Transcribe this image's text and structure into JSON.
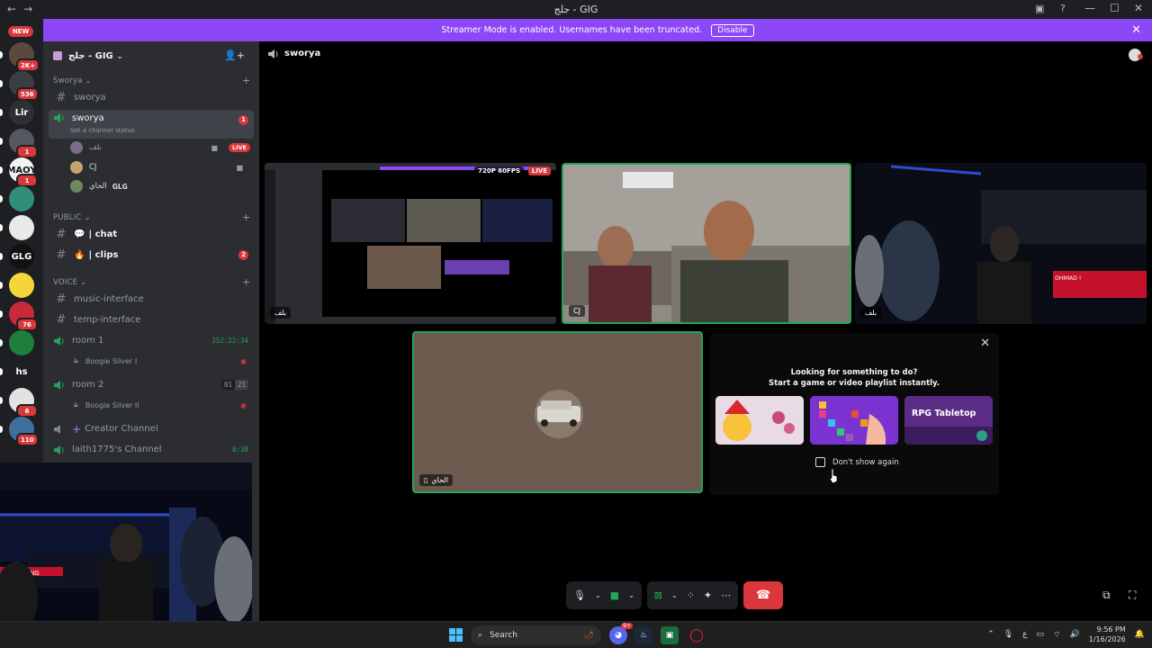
{
  "window": {
    "title": "جلج - GIG",
    "nav_back": "←",
    "nav_fwd": "→"
  },
  "guilds": {
    "new_badge": "NEW",
    "items": [
      {
        "label": "",
        "badge": "2K+"
      },
      {
        "label": "",
        "badge": "536"
      },
      {
        "label": "Lir",
        "badge": ""
      },
      {
        "label": "",
        "badge": "1"
      },
      {
        "label": "MAOY",
        "badge": "1"
      },
      {
        "label": "",
        "badge": ""
      },
      {
        "label": "",
        "badge": ""
      },
      {
        "label": "GLG",
        "badge": ""
      },
      {
        "label": "",
        "badge": ""
      },
      {
        "label": "",
        "badge": "76"
      },
      {
        "label": "",
        "badge": ""
      },
      {
        "label": "hs",
        "badge": ""
      },
      {
        "label": "",
        "badge": "6"
      },
      {
        "label": "",
        "badge": "110"
      }
    ]
  },
  "banner": {
    "text": "Streamer Mode is enabled. Usernames have been truncated.",
    "button": "Disable"
  },
  "server": {
    "name": "جلج - GIG"
  },
  "sidebar": {
    "cat_sworya": "Sworya",
    "ch_sworya_text": "sworya",
    "ch_sworya_voice": "sworya",
    "channel_status": "Set a channel status",
    "unread_count": "1",
    "users": [
      {
        "name": "بلف",
        "live": "LIVE"
      },
      {
        "name": "CJ",
        "live": ""
      },
      {
        "name": "الحاي",
        "tag": "GLG"
      }
    ],
    "cat_public": "PUBLIC",
    "ch_chat": "| chat",
    "ch_clips": "| clips",
    "clips_count": "2",
    "cat_voice": "VOICE",
    "ch_music": "music-interface",
    "ch_temp": "temp-interface",
    "room1": "room 1",
    "room1_timer": "252:22:34",
    "room1_user": "Boogie Silver I",
    "room2": "room 2",
    "room2_a": "01",
    "room2_b": "21",
    "room2_user": "Boogie Silver II",
    "creator": "Creator Channel",
    "laith": "laith1775's Channel",
    "laith_timer": "0:38"
  },
  "call": {
    "channel_name": "sworya",
    "tiles": {
      "stream_badge": "720P 60FPS",
      "stream_live": "LIVE",
      "stream_name": "بلف",
      "cam_name": "CJ",
      "cam2_name": "بلف",
      "avatar_name": "الحاي",
      "room_sign": "OHIMAD !"
    },
    "activity": {
      "title1": "Looking for something to do?",
      "title2": "Start a game or video playlist instantly.",
      "card3": "RPG Tabletop",
      "dont_show": "Don't show again"
    }
  },
  "pip": {
    "sign": "E GAMING"
  },
  "taskbar": {
    "search": "Search",
    "discord_badge": "9+",
    "lang": "ع",
    "time": "9:56 PM",
    "date": "1/16/2026"
  },
  "colors": {
    "accent": "#8c47f6",
    "danger": "#da373c",
    "online": "#23a55a",
    "sidebar": "#2b2d31"
  }
}
